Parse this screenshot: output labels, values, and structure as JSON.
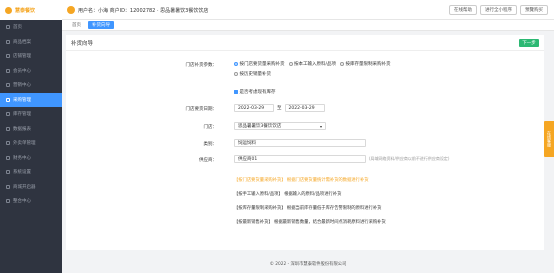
{
  "logo": {
    "text": "慧泰餐饮"
  },
  "user": {
    "text": "用户名：小海  商户ID：12002782 ·  思品暑暑饮3餐饮饮店"
  },
  "top_actions": [
    "在线帮助",
    "进行全小程序",
    "預覽购买"
  ],
  "sidebar": {
    "items": [
      {
        "label": "首页"
      },
      {
        "label": "商品档案"
      },
      {
        "label": "店铺管理"
      },
      {
        "label": "会员中心"
      },
      {
        "label": "营销中心"
      },
      {
        "label": "采购管理"
      },
      {
        "label": "库存管理"
      },
      {
        "label": "数据报表"
      },
      {
        "label": "外卖单管理"
      },
      {
        "label": "财务中心"
      },
      {
        "label": "系统设置"
      },
      {
        "label": "商城开启器"
      },
      {
        "label": "整合中心"
      }
    ],
    "active_index": 5
  },
  "tabs": [
    {
      "label": "首页"
    },
    {
      "label": "补货向导"
    }
  ],
  "panel": {
    "title": "补货向导",
    "next_label": "下一步",
    "param_label": "门店补货参数：",
    "params": [
      {
        "label": "按门店要货量采购补货",
        "on": true
      },
      {
        "label": "按本工输入原料/品项",
        "on": false
      },
      {
        "label": "按库存量限制采购补货",
        "on": false
      },
      {
        "label": "按历史销量补货",
        "on": false
      }
    ],
    "checkbox_label": "是否考虑现有库存",
    "date_label": "门店要货日期：",
    "date_from": "2022-03-29",
    "date_sep": "至",
    "date_to": "2022-03-29",
    "store_label": "门店：",
    "store_value": "思品暑暑饮3餐饮饮店",
    "category_label": "类别：",
    "category_value": "饲运饲料",
    "supplier_label": "供应商：",
    "supplier_value": "供应商01",
    "supplier_hint": "(局域网络资料/供应商以前不进行供应商设定)",
    "notes": [
      {
        "text": "【按门店要货量采购补货】 根据门店要货量统计需补货的数据进行补货",
        "orange": true
      },
      {
        "text": "【按手工输入原料/品项】 根据输入的原料/品项进行补货",
        "orange": false
      },
      {
        "text": "【按库存量限制采购补货】 根据当前库存量低于库存告警限制的原料进行补货",
        "orange": false
      },
      {
        "text": "【按最新销售补货】 根据最新销售数量，结合最新时间点消耗原料进行采购补货",
        "orange": false
      }
    ]
  },
  "footer": {
    "text": "© 2022 - 深圳市慧泰软件股份有限公司"
  },
  "float_tab": {
    "text": "在线客服"
  },
  "colors": {
    "primary": "#4096ff",
    "accent": "#f5a623",
    "success": "#2cb873",
    "sidebar": "#2f3440"
  }
}
